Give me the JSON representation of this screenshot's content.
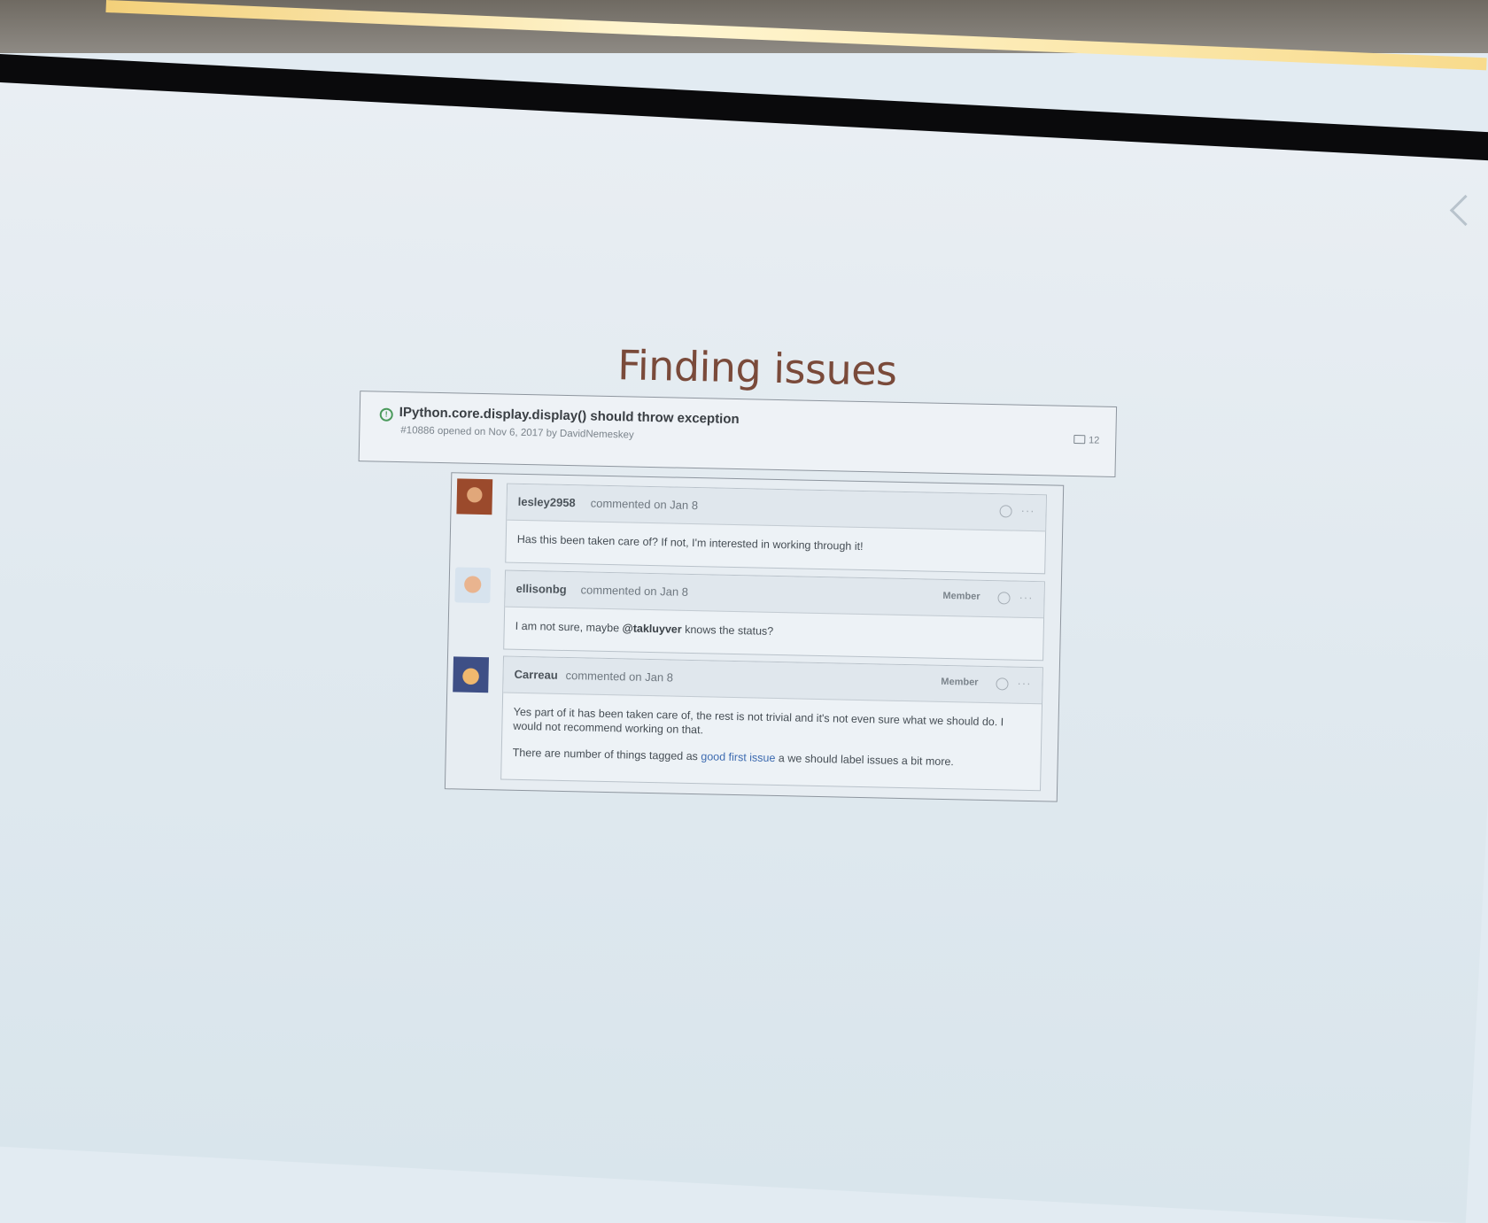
{
  "slide": {
    "title": "Finding issues"
  },
  "issue": {
    "title": "IPython.core.display.display() should throw exception",
    "meta": "#10886 opened on Nov 6, 2017 by DavidNemeskey",
    "comment_count": "12",
    "status_icon": "issue-opened-icon"
  },
  "comments": [
    {
      "author": "lesley2958",
      "date_text": "commented on Jan 8",
      "badge": "",
      "body": "Has this been taken care of? If not, I'm interested in working through it!"
    },
    {
      "author": "ellisonbg",
      "date_text": "commented on Jan 8",
      "badge": "Member",
      "body_prefix": "I am not sure, maybe ",
      "mention": "@takluyver",
      "body_suffix": " knows the status?"
    },
    {
      "author": "Carreau",
      "date_text": "commented on Jan 8",
      "badge": "Member",
      "body_p1": "Yes part of it has been taken care of, the rest is not trivial and it's not even sure what we should do. I would not recommend working on that.",
      "body_p2_prefix": "There are number of things tagged as ",
      "label_link": "good first issue",
      "body_p2_suffix": " a we should label issues a bit more."
    }
  ],
  "colors": {
    "title": "#7a4a3a",
    "link": "#3d6bb0",
    "open_status": "#4a9a5b"
  }
}
